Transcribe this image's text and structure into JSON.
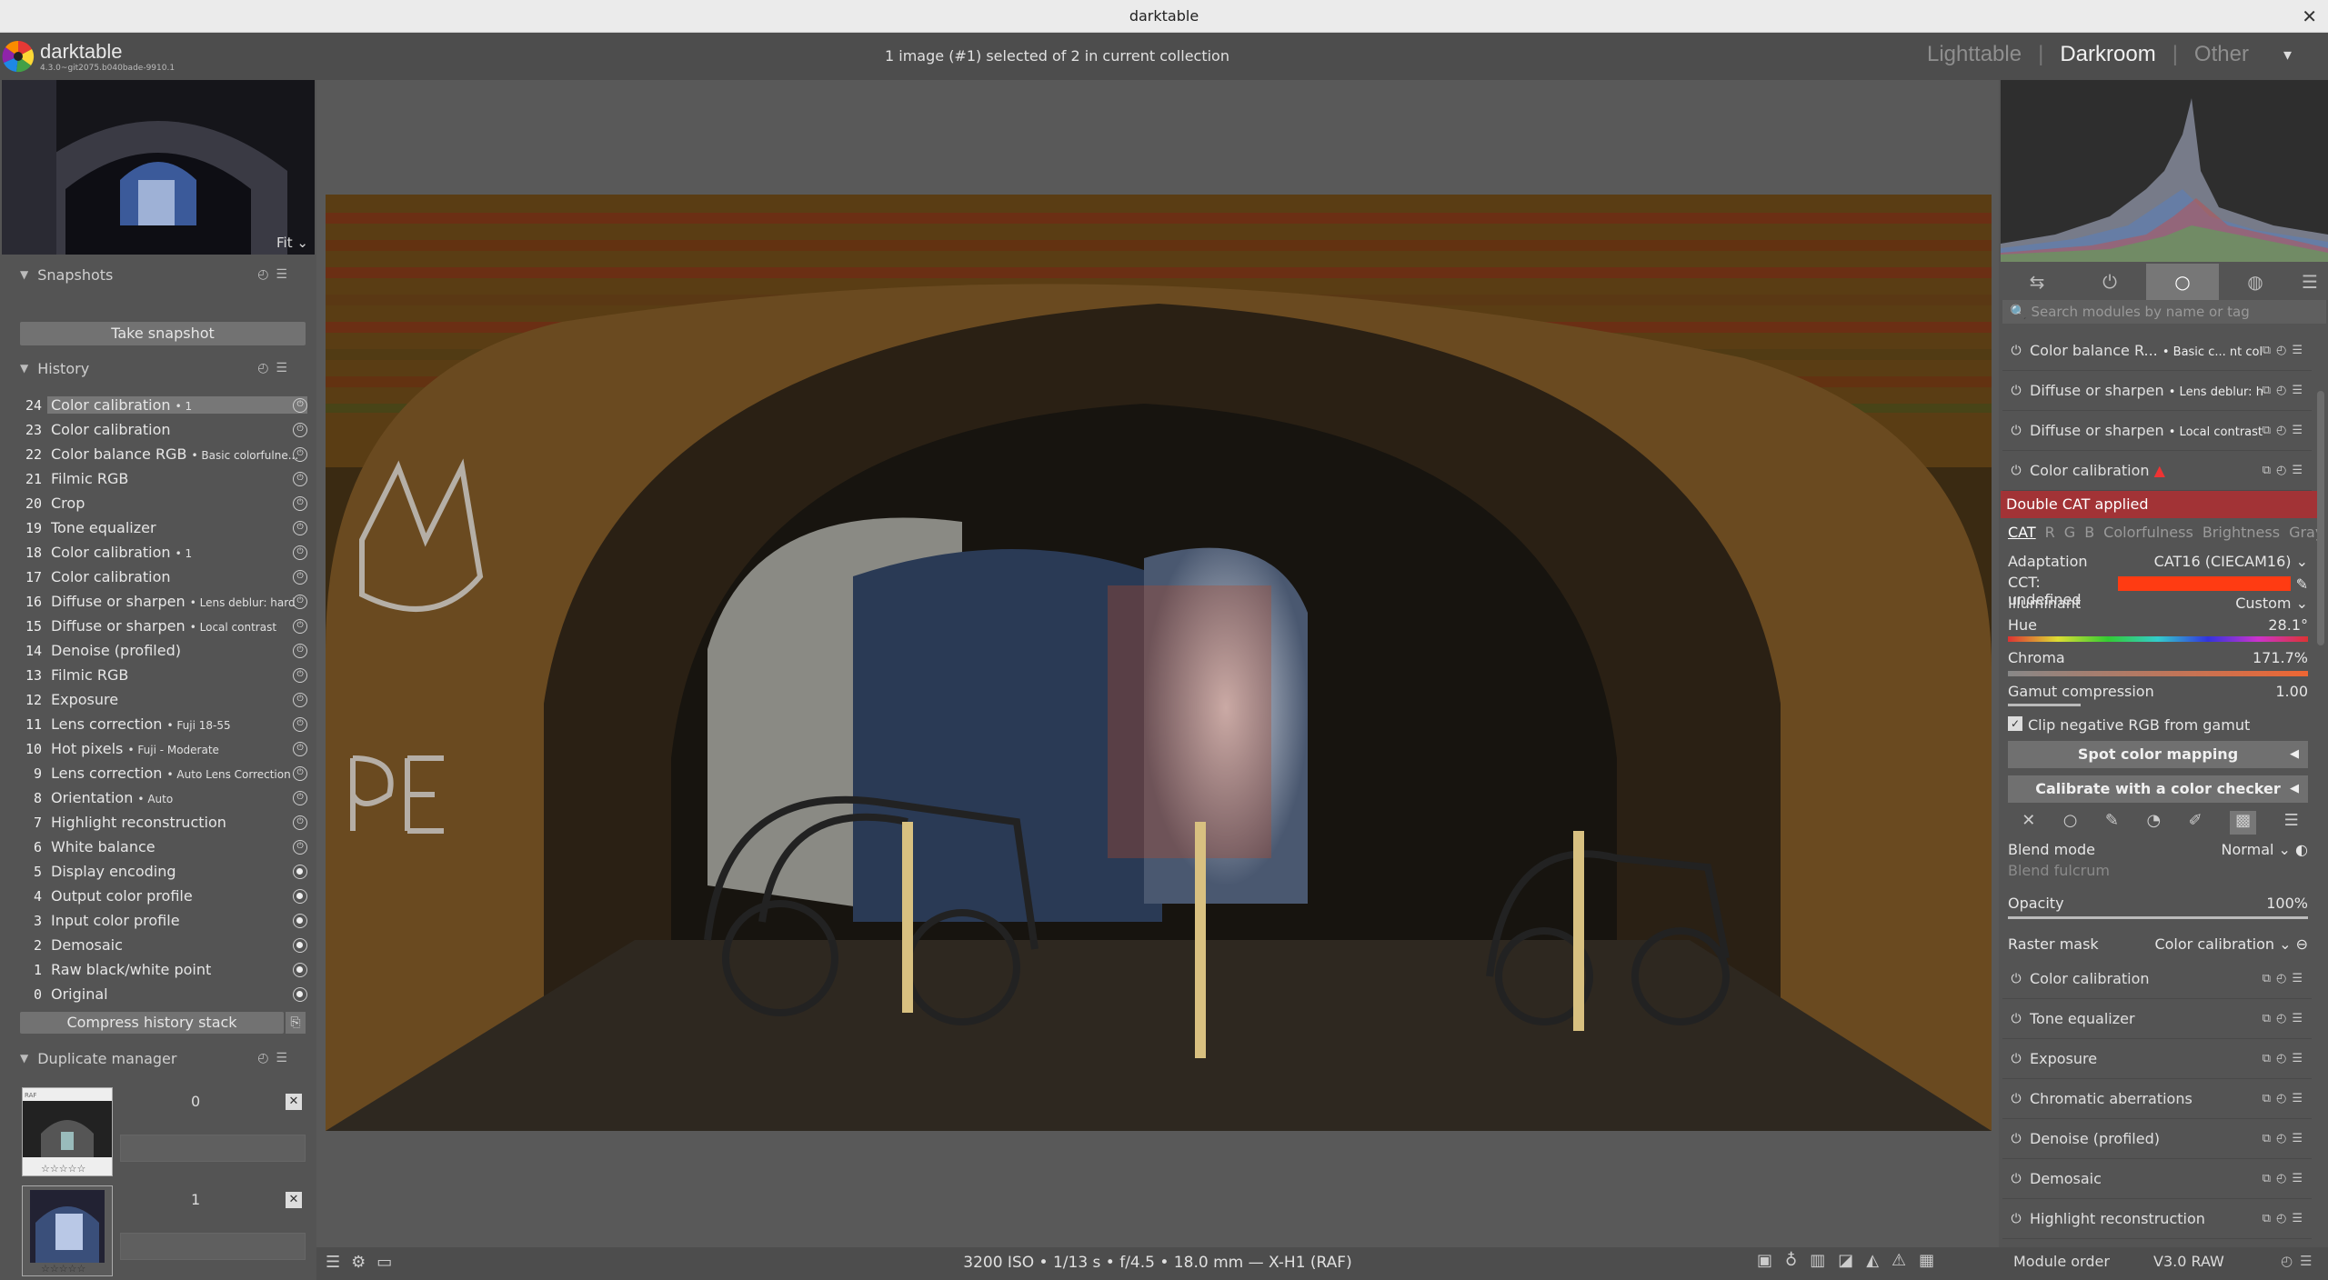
{
  "window": {
    "title": "darktable",
    "close": "✕"
  },
  "header": {
    "brand": "darktable",
    "version": "4.3.0~git2075.b040bade-9910.1",
    "collection_info": "1 image (#1) selected of 2 in current collection",
    "views": [
      "Lighttable",
      "Darkroom",
      "Other"
    ],
    "active_view": "Darkroom"
  },
  "navigation": {
    "zoom": "Fit ⌄"
  },
  "snapshots": {
    "title": "Snapshots",
    "take_label": "Take snapshot"
  },
  "history": {
    "title": "History",
    "items": [
      {
        "n": "24",
        "label": "Color calibration",
        "note": "• 1",
        "power": "on-mod"
      },
      {
        "n": "23",
        "label": "Color calibration",
        "note": "",
        "power": "mod"
      },
      {
        "n": "22",
        "label": "Color balance RGB",
        "note": "• Basic colorfulne...",
        "power": "mod"
      },
      {
        "n": "21",
        "label": "Filmic RGB",
        "note": "",
        "power": "mod"
      },
      {
        "n": "20",
        "label": "Crop",
        "note": "",
        "power": "mod"
      },
      {
        "n": "19",
        "label": "Tone equalizer",
        "note": "",
        "power": "mod"
      },
      {
        "n": "18",
        "label": "Color calibration",
        "note": "• 1",
        "power": "mod"
      },
      {
        "n": "17",
        "label": "Color calibration",
        "note": "",
        "power": "mod"
      },
      {
        "n": "16",
        "label": "Diffuse or sharpen",
        "note": "• Lens deblur: hard",
        "power": "mod"
      },
      {
        "n": "15",
        "label": "Diffuse or sharpen",
        "note": "• Local contrast",
        "power": "mod"
      },
      {
        "n": "14",
        "label": "Denoise (profiled)",
        "note": "",
        "power": "mod"
      },
      {
        "n": "13",
        "label": "Filmic RGB",
        "note": "",
        "power": "mod"
      },
      {
        "n": "12",
        "label": "Exposure",
        "note": "",
        "power": "mod"
      },
      {
        "n": "11",
        "label": "Lens correction",
        "note": "• Fuji 18-55",
        "power": "mod"
      },
      {
        "n": "10",
        "label": "Hot pixels",
        "note": "• Fuji - Moderate",
        "power": "mod"
      },
      {
        "n": "9",
        "label": "Lens correction",
        "note": "• Auto Lens Correction",
        "power": "mod"
      },
      {
        "n": "8",
        "label": "Orientation",
        "note": "• Auto",
        "power": "mod"
      },
      {
        "n": "7",
        "label": "Highlight reconstruction",
        "note": "",
        "power": "mod"
      },
      {
        "n": "6",
        "label": "White balance",
        "note": "",
        "power": "mod"
      },
      {
        "n": "5",
        "label": "Display encoding",
        "note": "",
        "power": "on"
      },
      {
        "n": "4",
        "label": "Output color profile",
        "note": "",
        "power": "on"
      },
      {
        "n": "3",
        "label": "Input color profile",
        "note": "",
        "power": "on"
      },
      {
        "n": "2",
        "label": "Demosaic",
        "note": "",
        "power": "on"
      },
      {
        "n": "1",
        "label": "Raw black/white point",
        "note": "",
        "power": "on"
      },
      {
        "n": "0",
        "label": "Original",
        "note": "",
        "power": "on"
      }
    ],
    "compress_label": "Compress history stack"
  },
  "duplicate_manager": {
    "title": "Duplicate manager",
    "items": [
      {
        "n": "0",
        "stars": "☆☆☆☆☆",
        "label": "RAF"
      },
      {
        "n": "1",
        "stars": "☆☆☆☆☆",
        "label": ""
      }
    ]
  },
  "footer": {
    "exif": "3200 ISO • 1/13 s • f/4.5 • 18.0 mm — X-H1 (RAF)"
  },
  "right": {
    "search_placeholder": "Search modules by name or tag",
    "modules_top": [
      {
        "name": "Color balance R...",
        "note": "• Basic c... nt colors"
      },
      {
        "name": "Diffuse or sharpen",
        "note": "• Lens deblur: hard"
      },
      {
        "name": "Diffuse or sharpen",
        "note": "• Local contrast"
      },
      {
        "name": "Color calibration",
        "note": ""
      }
    ],
    "warning": "Double CAT applied",
    "tabs": [
      "CAT",
      "R",
      "G",
      "B",
      "Colorfulness",
      "Brightness",
      "Gray"
    ],
    "params": {
      "adaptation_label": "Adaptation",
      "adaptation_value": "CAT16 (CIECAM16) ⌄",
      "cct_label": "CCT: undefined",
      "illuminant_label": "Illuminant",
      "illuminant_value": "Custom ⌄",
      "hue_label": "Hue",
      "hue_value": "28.1°",
      "chroma_label": "Chroma",
      "chroma_value": "171.7%",
      "gamut_label": "Gamut compression",
      "gamut_value": "1.00",
      "clip_label": "Clip negative RGB from gamut",
      "spot_label": "Spot color mapping",
      "checker_label": "Calibrate with a color checker",
      "blend_label": "Blend mode",
      "blend_value": "Normal ⌄",
      "fulcrum_label": "Blend fulcrum",
      "opacity_label": "Opacity",
      "opacity_value": "100%",
      "raster_label": "Raster mask",
      "raster_value": "Color calibration ⌄"
    },
    "modules_bottom": [
      "Color calibration",
      "Tone equalizer",
      "Exposure",
      "Chromatic aberrations",
      "Denoise (profiled)",
      "Demosaic",
      "Highlight reconstruction"
    ],
    "module_order_label": "Module order",
    "module_order_value": "V3.0 RAW"
  },
  "colors": {
    "accent_warning": "#a23336",
    "cct_swatch": "#ff3b12"
  }
}
